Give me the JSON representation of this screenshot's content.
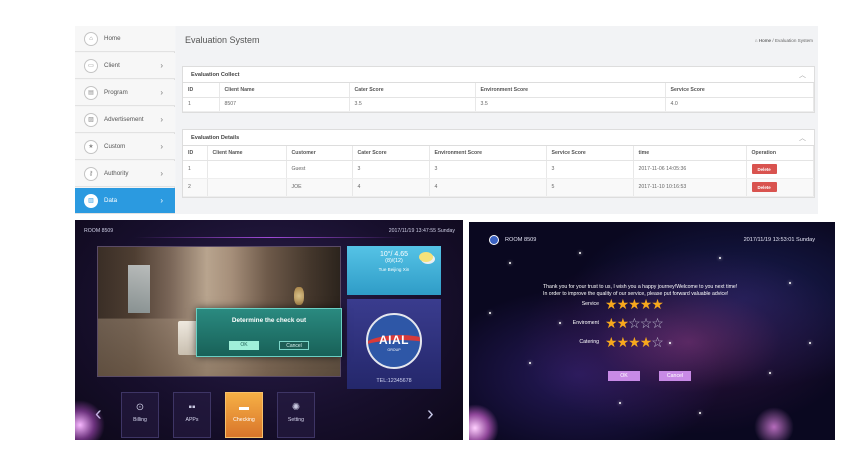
{
  "admin": {
    "sidebar": {
      "items": [
        {
          "label": "Home",
          "icon": "home-icon",
          "glyph": "⌂",
          "chevron": false,
          "active": false
        },
        {
          "label": "Client",
          "icon": "monitor-icon",
          "glyph": "▭",
          "chevron": true,
          "active": false
        },
        {
          "label": "Program",
          "icon": "film-icon",
          "glyph": "▤",
          "chevron": true,
          "active": false
        },
        {
          "label": "Advertisement",
          "icon": "image-icon",
          "glyph": "▨",
          "chevron": true,
          "active": false
        },
        {
          "label": "Custom",
          "icon": "star-icon",
          "glyph": "★",
          "chevron": true,
          "active": false
        },
        {
          "label": "Authority",
          "icon": "key-icon",
          "glyph": "⚷",
          "chevron": true,
          "active": false
        },
        {
          "label": "Data",
          "icon": "chart-icon",
          "glyph": "▥",
          "chevron": true,
          "active": true
        }
      ]
    },
    "page_title": "Evaluation System",
    "breadcrumb": {
      "home": "Home",
      "separator": "/",
      "current": "Evaluation System"
    },
    "collect": {
      "title": "Evaluation Collect",
      "columns": [
        "ID",
        "Client Name",
        "Cater Score",
        "Environment Score",
        "Service Score"
      ],
      "rows": [
        [
          "1",
          "8507",
          "3.5",
          "3.5",
          "4.0"
        ]
      ]
    },
    "details": {
      "title": "Evaluation Details",
      "columns": [
        "ID",
        "Client Name",
        "Customer",
        "Cater Score",
        "Environment Score",
        "Service Score",
        "time",
        "Operation"
      ],
      "rows": [
        [
          "1",
          "",
          "Guest",
          "3",
          "3",
          "3",
          "2017-11-06 14:05:36"
        ],
        [
          "2",
          "",
          "JOE",
          "4",
          "4",
          "5",
          "2017-11-10 10:16:53"
        ]
      ],
      "delete_label": "Delete"
    },
    "accent_color": "#2b9ae0",
    "delete_color": "#d9534f"
  },
  "tv_checkout": {
    "room": "ROOM 8509",
    "datetime": "2017/11/19 13:47:55 Sunday",
    "weather": {
      "temp": "10°/ 4.65",
      "range": "(8)/(12)",
      "sub": "Tue   Beijing   Xin"
    },
    "logo": {
      "text": "AIAL",
      "sub": "GROUP"
    },
    "tel": "TEL:12345678",
    "dialog": {
      "title": "Determine the check out",
      "ok": "OK",
      "cancel": "Cancel"
    },
    "menu": [
      {
        "label": "Billing",
        "icon": "billing-icon",
        "glyph": "⊙",
        "active": false
      },
      {
        "label": "APPs",
        "icon": "apps-icon",
        "glyph": "▪▪",
        "active": false
      },
      {
        "label": "Checking",
        "icon": "checkout-icon",
        "glyph": "▬",
        "active": true
      },
      {
        "label": "Setting",
        "icon": "gear-icon",
        "glyph": "✺",
        "active": false
      }
    ]
  },
  "tv_feedback": {
    "room": "ROOM 8509",
    "datetime": "2017/11/19 13:53:01 Sunday",
    "message_line1": "Thank you for your trust to us, I wish you a happy journey!Welcome to you next time!",
    "message_line2": "In order to improve the quality of our service, please put forward valuable advice!",
    "ratings": [
      {
        "label": "Service",
        "stars": 5,
        "max": 5
      },
      {
        "label": "Enviroment",
        "stars": 2,
        "max": 5
      },
      {
        "label": "Catering",
        "stars": 4,
        "max": 5
      }
    ],
    "ok": "OK",
    "cancel": "Cancel",
    "star_color": "#f7a81d"
  }
}
